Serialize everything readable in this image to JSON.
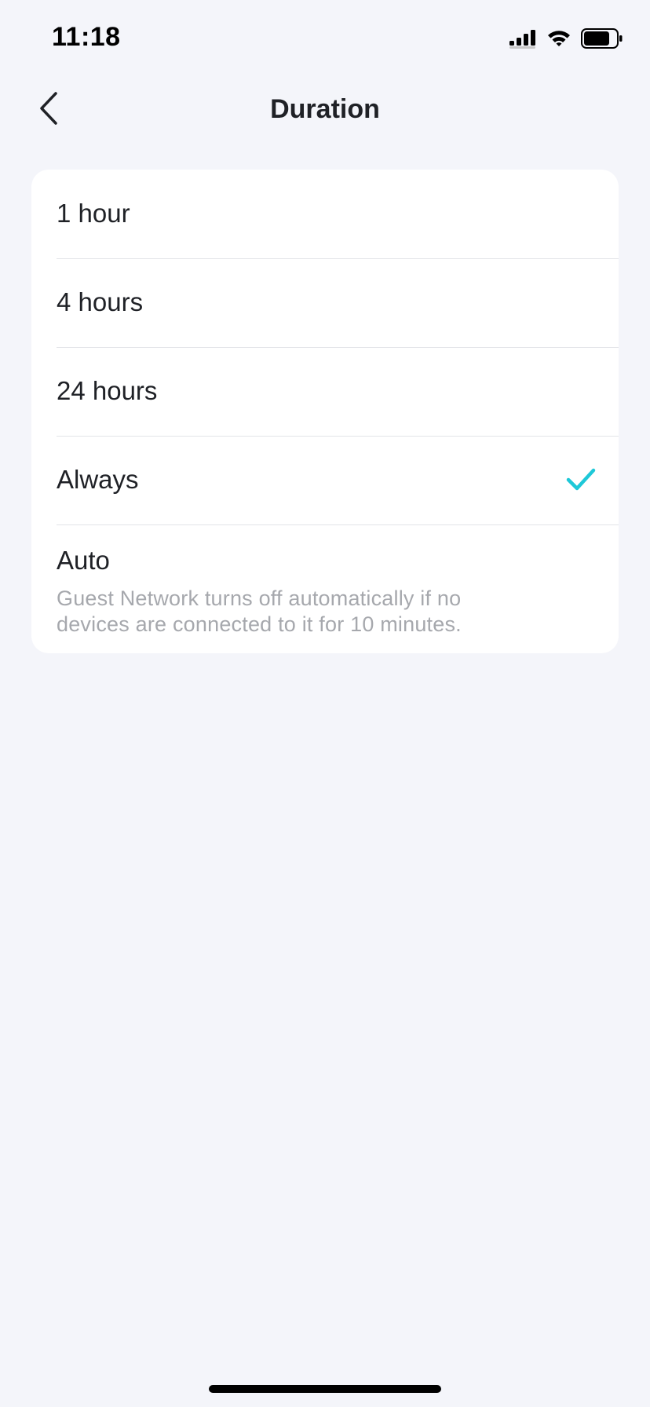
{
  "status_bar": {
    "time": "11:18",
    "icons": [
      "cellular-signal-icon",
      "wifi-icon",
      "battery-icon"
    ],
    "battery_level": 0.8
  },
  "nav": {
    "title": "Duration",
    "back_icon": "chevron-left-icon"
  },
  "options": [
    {
      "label": "1 hour",
      "selected": false
    },
    {
      "label": "4 hours",
      "selected": false
    },
    {
      "label": "24 hours",
      "selected": false
    },
    {
      "label": "Always",
      "selected": true
    },
    {
      "label": "Auto",
      "selected": false,
      "description": "Guest Network turns off automatically if no devices are connected to it for 10 minutes."
    }
  ],
  "colors": {
    "background": "#f4f5fa",
    "card": "#ffffff",
    "accent": "#1ec8d8",
    "text_primary": "#1f2126",
    "text_secondary": "#a6a8ad",
    "divider": "#e3e4e8"
  }
}
